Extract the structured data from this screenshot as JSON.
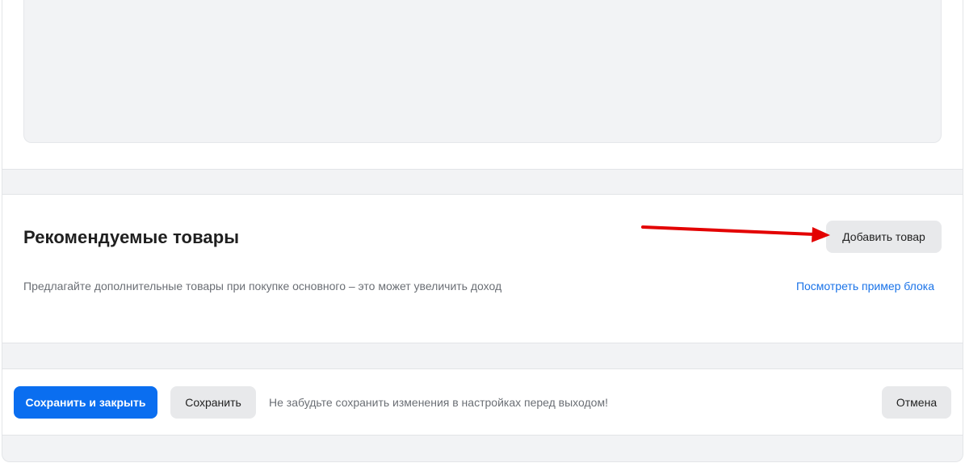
{
  "recommended": {
    "title": "Рекомендуемые товары",
    "description": "Предлагайте дополнительные товары при покупке основного – это может увеличить доход",
    "add_button": "Добавить товар",
    "example_link": "Посмотреть пример блока"
  },
  "footer": {
    "save_close_button": "Сохранить и закрыть",
    "save_button": "Сохранить",
    "hint": "Не забудьте сохранить изменения в настройках перед выходом!",
    "cancel_button": "Отмена"
  },
  "colors": {
    "accent": "#0a6ef0",
    "link": "#1a73e8",
    "annotation_arrow": "#e30000",
    "page_background": "#f2f3f5"
  }
}
